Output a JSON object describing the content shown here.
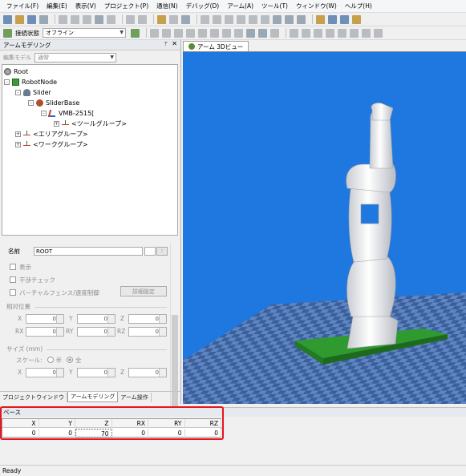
{
  "menu": [
    "ファイル(F)",
    "編集(E)",
    "表示(V)",
    "プロジェクト(P)",
    "通信(N)",
    "デバッグ(D)",
    "アーム(A)",
    "ツール(T)",
    "ウィンドウ(W)",
    "ヘルプ(H)"
  ],
  "toolbar2": {
    "status_label": "接続状態",
    "status_value": "オフライン"
  },
  "left_panel": {
    "title": "アームモデリング",
    "pin": "ᛘ",
    "close": "✕",
    "edit_mode_label": "編集モデル",
    "edit_mode_value": "通常"
  },
  "tree": [
    {
      "label": "Root",
      "icon": "root-icon",
      "expander": ""
    },
    {
      "label": "RobotNode",
      "icon": "robot-node-icon",
      "expander": "-"
    },
    {
      "label": "Slider",
      "icon": "slider-icon",
      "expander": "-"
    },
    {
      "label": "SliderBase",
      "icon": "slider-base-icon",
      "expander": "-"
    },
    {
      "label": "VMB-2515[",
      "icon": "arm-icon",
      "expander": "-"
    },
    {
      "label": "<ツールグループ>",
      "icon": "group-icon",
      "expander": "+"
    },
    {
      "label": "<エリアグループ>",
      "icon": "group-icon",
      "expander": "+"
    },
    {
      "label": "<ワークグループ>",
      "icon": "group-icon",
      "expander": "+"
    }
  ],
  "props": {
    "name_label": "名前",
    "name_value": "ROOT",
    "name_btn2": "!",
    "show_label": "表示",
    "interference_label": "干渉チェック",
    "virtual_fence_label": "バーチャルフェンス/速度制御",
    "detail_btn": "詳細設定",
    "relpos_title": "相対位置",
    "x_label": "X",
    "y_label": "Y",
    "z_label": "Z",
    "rx_label": "RX",
    "ry_label": "RY",
    "rz_label": "RZ",
    "x_value": "0",
    "y_value": "0",
    "z_value": "0",
    "rx_value": "0",
    "ry_value": "0",
    "rz_value": "0",
    "size_title": "サイズ (mm)",
    "scale_label": "スケール:",
    "half_label": "半",
    "full_label": "全",
    "sx_value": "0",
    "sy_value": "0",
    "sz_value": "0"
  },
  "bottom_tabs": [
    "プロジェクトウインドウ",
    "アームモデリング",
    "アーム操作"
  ],
  "view_tab": "アーム 3Dビュー",
  "base": {
    "title": "ベース",
    "headers": [
      "X",
      "Y",
      "Z",
      "RX",
      "RY",
      "RZ"
    ],
    "values": [
      "0",
      "0",
      "70",
      "0",
      "0",
      "0"
    ]
  },
  "status": "Ready",
  "colors": {
    "highlight": "#e8151c",
    "viewport": "#1f78e0",
    "floor_dark": "#3a5f9a",
    "floor_light": "#5f86c2",
    "base_green": "#2f9a2f"
  }
}
